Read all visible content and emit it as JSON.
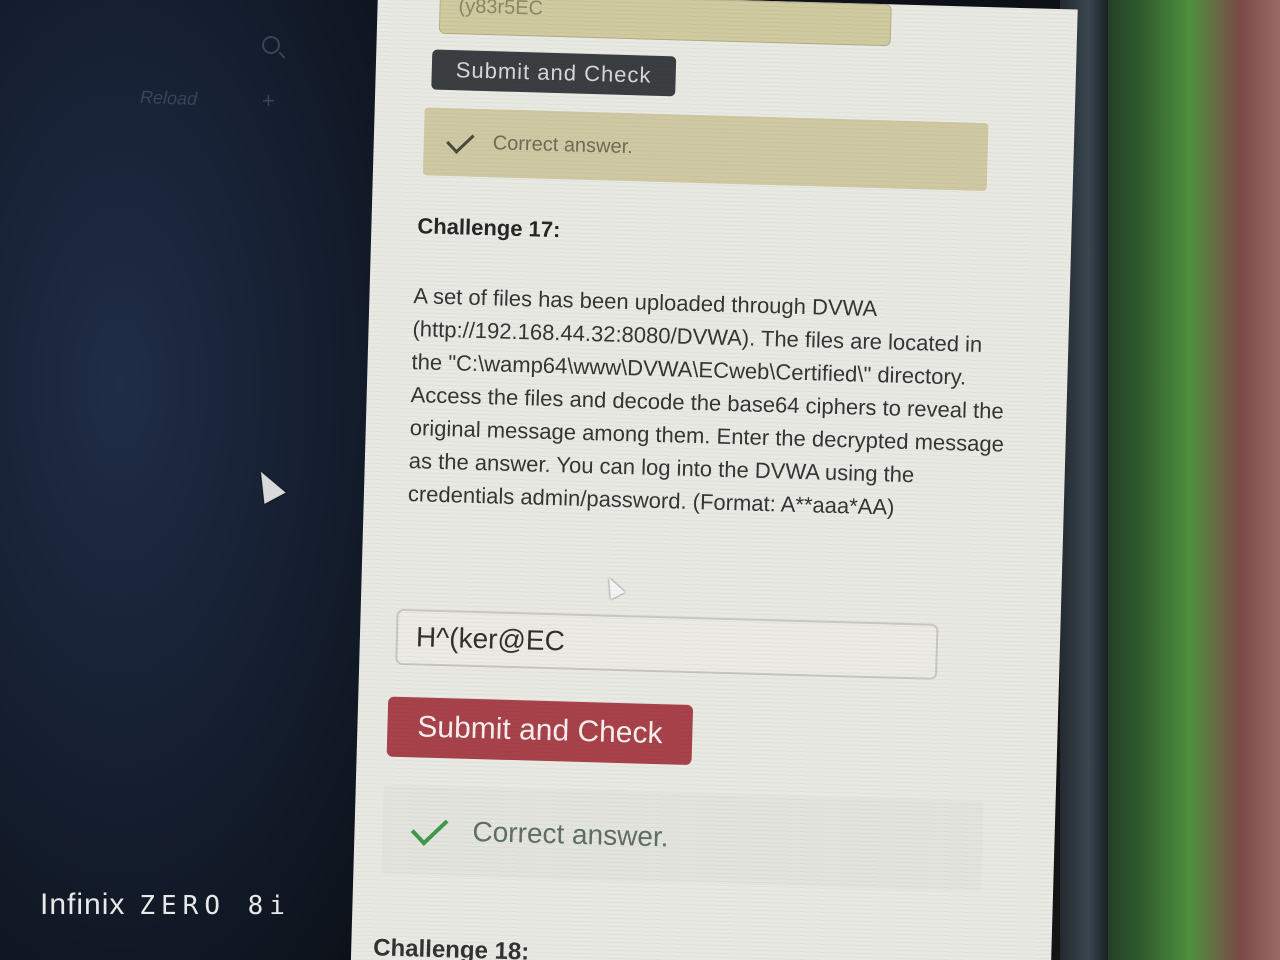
{
  "sidebar": {
    "reload_label": "Reload",
    "plus_icon": "+"
  },
  "watermark": {
    "brand": "Infinix",
    "model": "ZERO 8i"
  },
  "previous_challenge": {
    "input_value": "(y83r5EC",
    "submit_label": "Submit and Check",
    "result_text": "Correct answer."
  },
  "challenge": {
    "title": "Challenge 17:",
    "description": "A set of files has been uploaded through DVWA (http://192.168.44.32:8080/DVWA). The files are located in the \"C:\\wamp64\\www\\DVWA\\ECweb\\Certified\\\" directory. Access the files and decode the base64 ciphers to reveal the original message among them. Enter the decrypted message as the answer. You can log into the DVWA using the credentials admin/password. (Format: A**aaa*AA)",
    "answer_value": "H^(ker@EC",
    "submit_label": "Submit and Check",
    "result_text": "Correct answer."
  },
  "next_challenge": {
    "title": "Challenge 18:"
  },
  "colors": {
    "submit_button": "#a8424a",
    "prev_result_bg": "#cfc9a3",
    "check_green": "#3e9a4a"
  }
}
